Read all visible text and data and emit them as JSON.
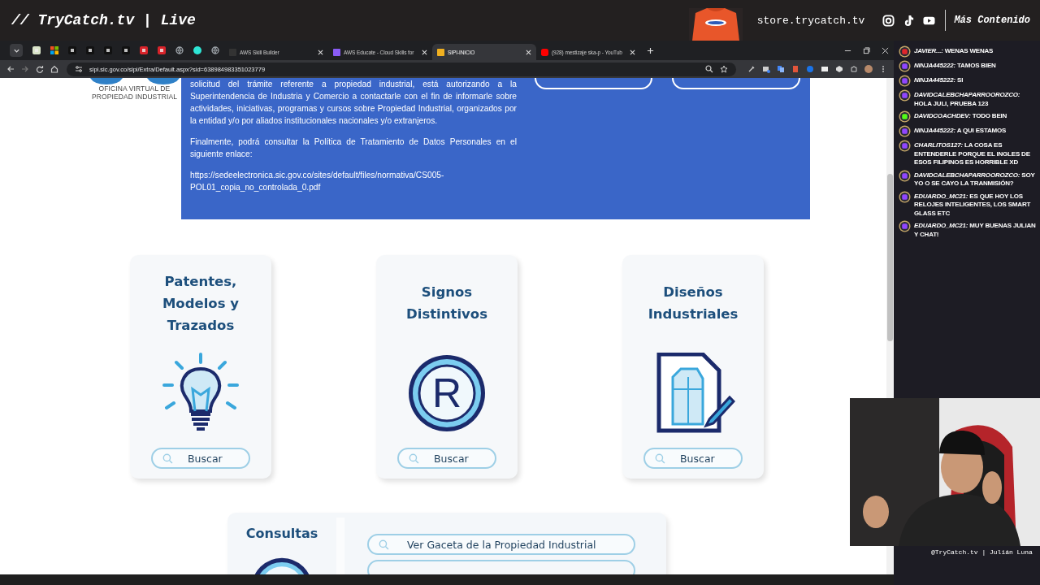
{
  "stream_header": {
    "title": "// TryCatch.tv | Live",
    "store": "store.trycatch.tv",
    "more": "Más Contenido"
  },
  "browser": {
    "pinned_tabs": [
      {
        "kind": "app"
      },
      {
        "kind": "windows"
      },
      {
        "kind": "dark"
      },
      {
        "kind": "dark"
      },
      {
        "kind": "dark"
      },
      {
        "kind": "dark"
      },
      {
        "kind": "red"
      },
      {
        "kind": "red"
      },
      {
        "kind": "globe"
      },
      {
        "kind": "teal"
      },
      {
        "kind": "globe"
      }
    ],
    "tabs": [
      {
        "title": "AWS Skill Builder",
        "kind": "aws",
        "selected": false
      },
      {
        "title": "AWS Educate - Cloud Skills for",
        "kind": "cube",
        "selected": false
      },
      {
        "title": "SIPI-INICIO",
        "kind": "sipi",
        "selected": true
      },
      {
        "title": "(928) mestizaje ska-p - YouTub",
        "kind": "youtube",
        "selected": false
      }
    ],
    "url": "sipi.sic.gov.co/sipi/Extra/Default.aspx?sid=638984983351023779"
  },
  "page": {
    "logo_caption": [
      "OFICINA VIRTUAL DE",
      "PROPIEDAD INDUSTRIAL"
    ],
    "notice": {
      "paragraphs": [
        "solicitud del trámite referente a propiedad industrial, está autorizando a la Superintendencia de Industria y Comercio a contactarle con el fin de informarle sobre actividades, iniciativas, programas y cursos sobre Propiedad Industrial, organizados por la entidad y/o por aliados institucionales nacionales y/o extranjeros.",
        "Finalmente, podrá consultar la Política de Tratamiento de Datos Personales en el siguiente enlace:"
      ],
      "link": "https://sedeelectronica.sic.gov.co/sites/default/files/normativa/CS005-POL01_copia_no_controlada_0.pdf"
    },
    "cards": [
      {
        "title": "Patentes, Modelos y Trazados",
        "kind": "bulb",
        "button": "Buscar"
      },
      {
        "title": "Signos Distintivos",
        "kind": "registered",
        "symbol": "R",
        "button": "Buscar"
      },
      {
        "title": "Diseños Industriales",
        "kind": "design",
        "button": "Buscar"
      }
    ],
    "consultas": {
      "title": "Consultas",
      "button": "Ver Gaceta de la Propiedad Industrial"
    }
  },
  "chat": [
    {
      "kind": "youtube",
      "text": "*JAVIER...:* WENAS WENAS"
    },
    {
      "kind": "twitch",
      "text": "*NINJA445222:* TAMOS BIEN"
    },
    {
      "kind": "twitch",
      "text": "*NINJA445222:* SI"
    },
    {
      "kind": "twitch",
      "text": "*DAVIDCALEBCHAPARROOROZCO:* HOLA JULI, PRUEBA 123"
    },
    {
      "kind": "kick",
      "text": "*DAVIDCOACHDEV:* TODO BEIN"
    },
    {
      "kind": "twitch",
      "text": "*NINJA445222:* A QUI ESTAMOS"
    },
    {
      "kind": "twitch",
      "text": "*CHARLITOS127:* LA COSA ES ENTENDERLE PORQUE EL INGLES DE ESOS FILIPINOS ES HORRIBLE XD"
    },
    {
      "kind": "twitch",
      "text": "*DAVIDCALEBCHAPARROOROZCO:* SOY YO O SE CAYO LA TRANMISIÓN?"
    },
    {
      "kind": "twitch",
      "text": "*EDUARDO_MC21:* ES QUE HOY LOS RELOJES INTELIGENTES, LOS SMART GLASS ETC"
    },
    {
      "kind": "twitch",
      "text": "*EDUARDO_MC21:* MUY BUENAS JULIAN Y CHAT!"
    }
  ],
  "webcam": {
    "kind": "picture",
    "caption": "@TryCatch.tv | Julián Luna"
  }
}
